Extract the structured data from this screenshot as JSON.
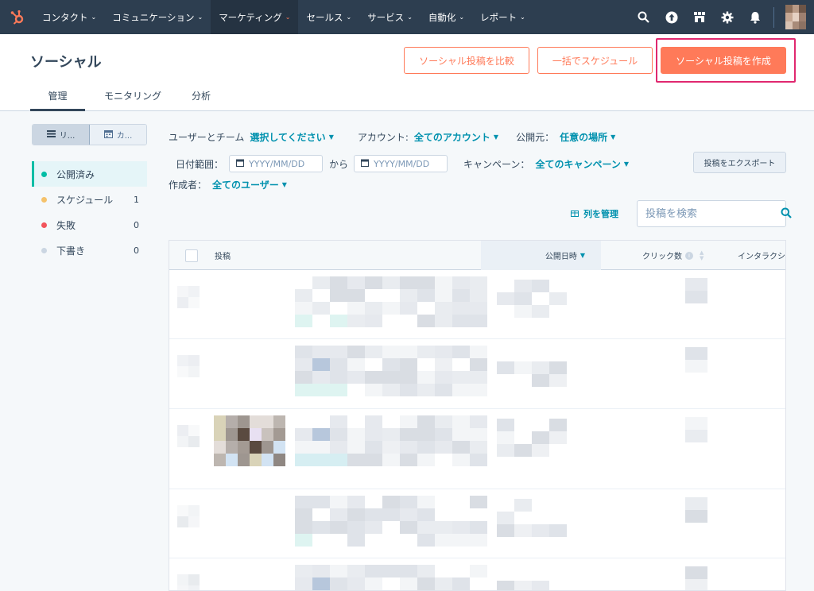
{
  "topnav": {
    "items": [
      {
        "label": "コンタクト",
        "active": false
      },
      {
        "label": "コミュニケーション",
        "active": false
      },
      {
        "label": "マーケティング",
        "active": true
      },
      {
        "label": "セールス",
        "active": false
      },
      {
        "label": "サービス",
        "active": false
      },
      {
        "label": "自動化",
        "active": false
      },
      {
        "label": "レポート",
        "active": false
      }
    ],
    "icons": [
      "search-icon",
      "upgrade-icon",
      "marketplace-icon",
      "settings-icon",
      "notifications-icon"
    ]
  },
  "header": {
    "title": "ソーシャル",
    "buttons": {
      "compare": "ソーシャル投稿を比較",
      "bulk_schedule": "一括でスケジュール",
      "create": "ソーシャル投稿を作成"
    },
    "tabs": [
      {
        "label": "管理",
        "active": true
      },
      {
        "label": "モニタリング",
        "active": false
      },
      {
        "label": "分析",
        "active": false
      }
    ]
  },
  "sidebar": {
    "view_toggle": {
      "list": "リ...",
      "calendar": "カ..."
    },
    "items": [
      {
        "label": "公開済み",
        "count": "",
        "color": "#00bda5",
        "active": true
      },
      {
        "label": "スケジュール",
        "count": "1",
        "color": "#f5c26b",
        "active": false
      },
      {
        "label": "失敗",
        "count": "0",
        "color": "#f2545b",
        "active": false
      },
      {
        "label": "下書き",
        "count": "0",
        "color": "#cbd6e2",
        "active": false
      }
    ]
  },
  "filters": {
    "users_label": "ユーザーとチーム",
    "users_value": "選択してください",
    "account_label": "アカウント:",
    "account_value": "全てのアカウント",
    "publisher_label": "公開元：",
    "publisher_value": "任意の場所",
    "date_label": "日付範囲：",
    "date_from_placeholder": "YYYY/MM/DD",
    "date_sep": "から",
    "date_to_placeholder": "YYYY/MM/DD",
    "campaign_label": "キャンペーン：",
    "campaign_value": "全てのキャンペーン",
    "author_label": "作成者：",
    "author_value": "全てのユーザー",
    "export_button": "投稿をエクスポート"
  },
  "table_tools": {
    "manage_columns": "列を管理",
    "search_placeholder": "投稿を検索"
  },
  "table": {
    "headers": {
      "post": "投稿",
      "published_at": "公開日時",
      "clicks": "クリック数",
      "interactions": "インタラクシ"
    },
    "row_count": 5
  },
  "colors": {
    "nav_bg": "#2d3e50",
    "accent": "#ff7a59",
    "link": "#0091ae",
    "highlight": "#e0286f"
  }
}
